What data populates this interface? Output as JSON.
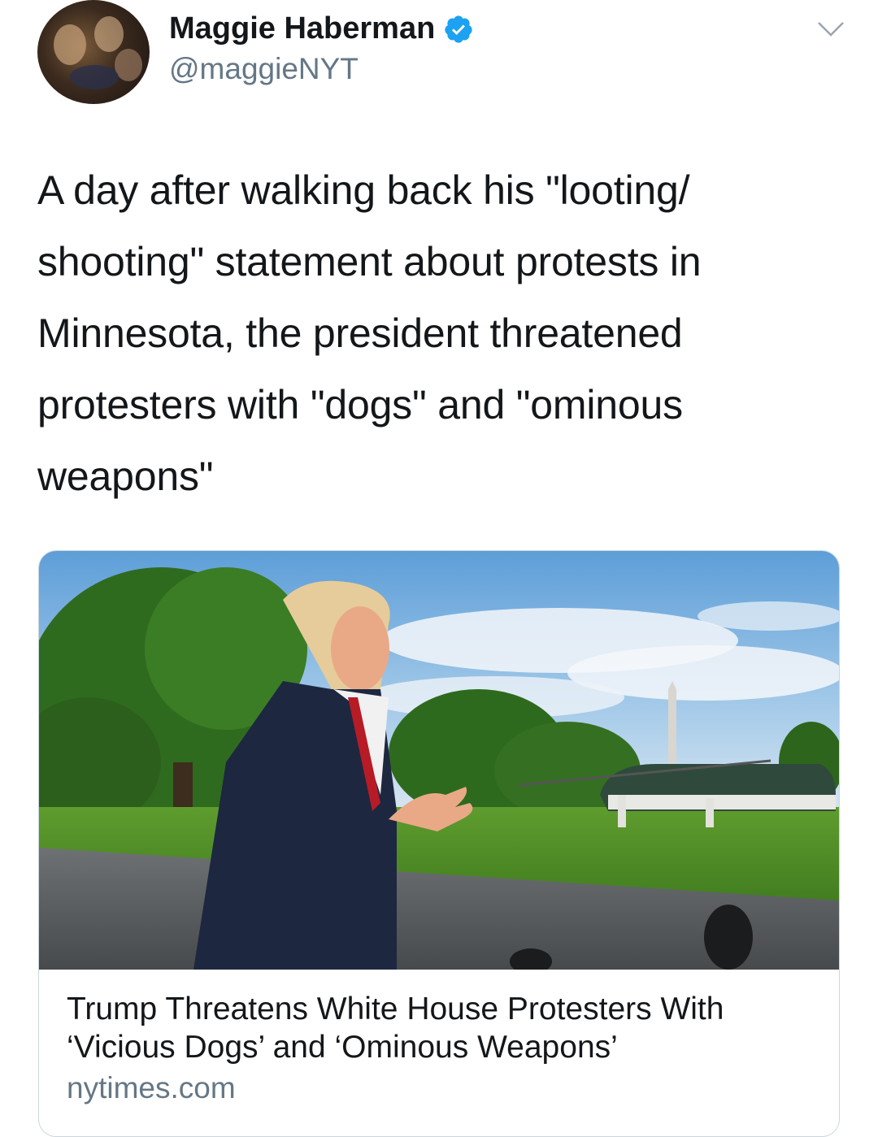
{
  "author": {
    "display_name": "Maggie Haberman",
    "handle": "@maggieNYT",
    "verified": true
  },
  "tweet": {
    "text": "A day after walking back his \"looting/ shooting\" statement about protests in Minnesota, the president threatened protesters with \"dogs\" and \"ominous weapons\""
  },
  "link_card": {
    "title": "Trump Threatens White House Protesters With ‘Vicious Dogs’ and ‘Ominous Weapons’",
    "domain": "nytimes.com"
  },
  "icons": {
    "verified": "verified-badge-icon",
    "menu": "chevron-down-icon"
  },
  "colors": {
    "verified_blue": "#1da1f2",
    "text": "#14171a",
    "secondary": "#657786",
    "border": "#ccd6dd"
  }
}
